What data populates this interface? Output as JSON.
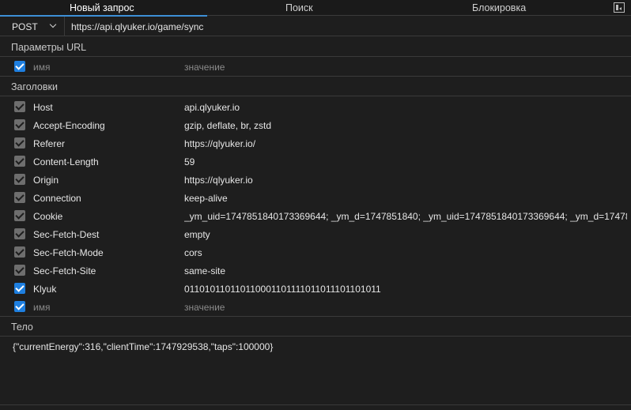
{
  "tabs": [
    {
      "label": "Новый запрос",
      "active": true
    },
    {
      "label": "Поиск",
      "active": false
    },
    {
      "label": "Блокировка",
      "active": false
    }
  ],
  "request": {
    "method": "POST",
    "url": "https://api.qlyuker.io/game/sync"
  },
  "sections": {
    "params": "Параметры URL",
    "headers": "Заголовки",
    "body": "Тело"
  },
  "placeholders": {
    "name": "имя",
    "value": "значение"
  },
  "headers": [
    {
      "name": "Host",
      "value": "api.qlyuker.io",
      "checked": "gray"
    },
    {
      "name": "Accept-Encoding",
      "value": "gzip, deflate, br, zstd",
      "checked": "gray"
    },
    {
      "name": "Referer",
      "value": "https://qlyuker.io/",
      "checked": "gray"
    },
    {
      "name": "Content-Length",
      "value": "59",
      "checked": "gray"
    },
    {
      "name": "Origin",
      "value": "https://qlyuker.io",
      "checked": "gray"
    },
    {
      "name": "Connection",
      "value": "keep-alive",
      "checked": "gray"
    },
    {
      "name": "Cookie",
      "value": "_ym_uid=1747851840173369644; _ym_d=1747851840; _ym_uid=1747851840173369644; _ym_d=1747851840; _y...",
      "checked": "gray"
    },
    {
      "name": "Sec-Fetch-Dest",
      "value": "empty",
      "checked": "gray"
    },
    {
      "name": "Sec-Fetch-Mode",
      "value": "cors",
      "checked": "gray"
    },
    {
      "name": "Sec-Fetch-Site",
      "value": "same-site",
      "checked": "gray"
    },
    {
      "name": "Klyuk",
      "value": "011010110110110001101111011011101101011",
      "checked": "blue"
    }
  ],
  "body": "{\"currentEnergy\":316,\"clientTime\":1747929538,\"taps\":100000}",
  "colors": {
    "accent": "#1e7fe0",
    "tab_underline": "#3d8fd6",
    "background": "#1e1e1e",
    "border": "#3a3a3a"
  }
}
